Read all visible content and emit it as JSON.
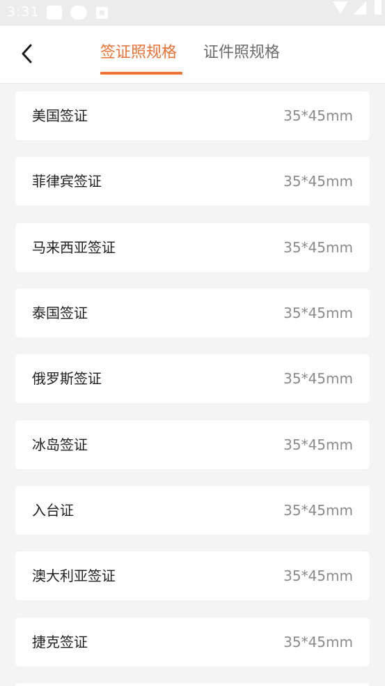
{
  "status_bar": {
    "time": "3:31",
    "icons": [
      "notification-square-icon",
      "notification-bubble-icon",
      "notification-app-icon",
      "wifi-icon",
      "signal-icon",
      "battery-icon"
    ]
  },
  "header": {
    "back_icon": "back-arrow-icon",
    "tabs": [
      {
        "label": "签证照规格",
        "active": true
      },
      {
        "label": "证件照规格",
        "active": false
      }
    ],
    "accent_color": "#ee7133"
  },
  "items": [
    {
      "name": "美国签证",
      "size": "35*45mm"
    },
    {
      "name": "菲律宾签证",
      "size": "35*45mm"
    },
    {
      "name": "马来西亚签证",
      "size": "35*45mm"
    },
    {
      "name": "泰国签证",
      "size": "35*45mm"
    },
    {
      "name": "俄罗斯签证",
      "size": "35*45mm"
    },
    {
      "name": "冰岛签证",
      "size": "35*45mm"
    },
    {
      "name": "入台证",
      "size": "35*45mm"
    },
    {
      "name": "澳大利亚签证",
      "size": "35*45mm"
    },
    {
      "name": "捷克签证",
      "size": "35*45mm"
    }
  ]
}
